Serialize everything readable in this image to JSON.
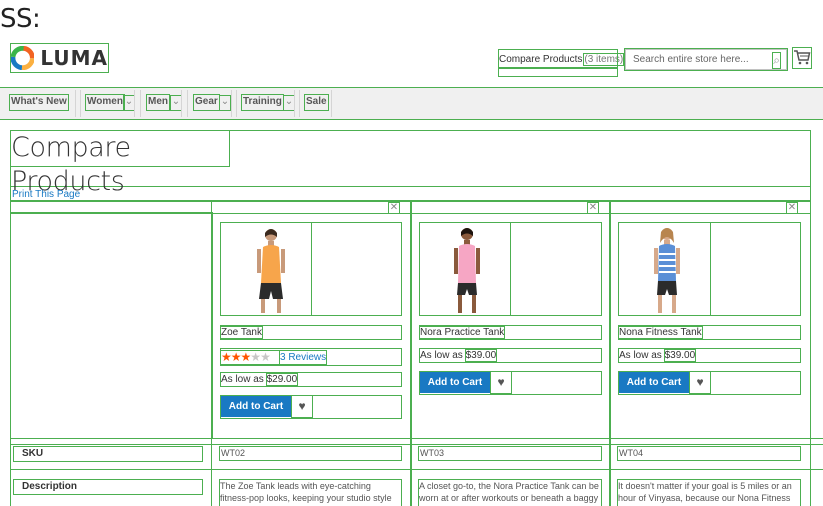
{
  "overlay_label": "SS:",
  "header": {
    "logo_text": "LUMA",
    "compare_label": "Compare Products",
    "compare_count": "(3 items)",
    "search_placeholder": "Search entire store here...",
    "icons": {
      "search": "magnifier-icon",
      "cart": "cart-icon"
    }
  },
  "nav": {
    "items": [
      "What's New",
      "Women",
      "Men",
      "Gear",
      "Training",
      "Sale"
    ]
  },
  "page": {
    "title": "Compare Products",
    "print_link": "Print This Page"
  },
  "products": [
    {
      "name": "Zoe Tank",
      "rating_filled": 3,
      "rating_max": 5,
      "reviews": "3 Reviews",
      "price_prefix": "As low as",
      "price": "$29.00",
      "add_to_cart": "Add to Cart",
      "sku": "WT02",
      "description": "The Zoe Tank leads with eye-catching fitness-pop looks, keeping your studio style uptrend.",
      "tank_color": "#f7a54b",
      "shorts_color": "#2b2b2b"
    },
    {
      "name": "Nora Practice Tank",
      "price_prefix": "As low as",
      "price": "$39.00",
      "add_to_cart": "Add to Cart",
      "sku": "WT03",
      "description": "A closet go-to, the Nora Practice Tank can be worn at or after workouts or beneath a baggy",
      "tank_color": "#f6a6c4",
      "shorts_color": "#2b2b2b"
    },
    {
      "name": "Nona Fitness Tank",
      "price_prefix": "As low as",
      "price": "$39.00",
      "add_to_cart": "Add to Cart",
      "sku": "WT04",
      "description": "It doesn't matter if your goal is 5 miles or an hour of Vinyasa, because our Nona Fitness",
      "tank_color": "#5b8fd6",
      "shorts_color": "#2b2b2b"
    }
  ],
  "attributes": {
    "sku_label": "SKU",
    "description_label": "Description"
  },
  "colors": {
    "accent": "#1979c3",
    "rating": "#ff5501",
    "outline": "#4caf50"
  }
}
